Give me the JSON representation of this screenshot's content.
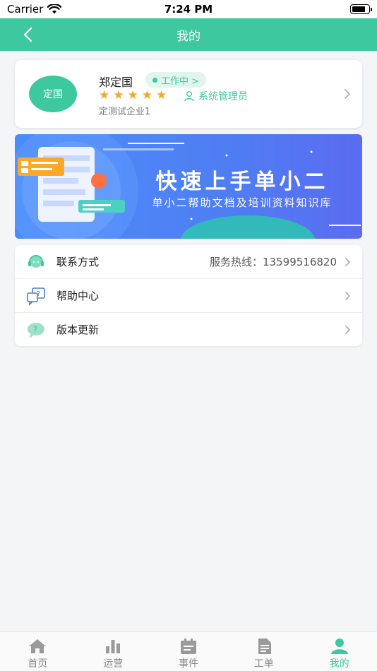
{
  "status_bar": {
    "carrier": "Carrier",
    "time": "7:24 PM"
  },
  "nav": {
    "title": "我的"
  },
  "profile": {
    "avatar_text": "定国",
    "name": "郑定国",
    "status_badge": "工作中 >",
    "rating_stars": 5,
    "role": "系统管理员",
    "company": "定测试企业1"
  },
  "banner": {
    "title": "快速上手单小二",
    "subtitle": "单小二帮助文档及培训资料知识库"
  },
  "menu": {
    "items": [
      {
        "label": "联系方式",
        "value": "服务热线：13599516820",
        "icon": "headset-icon"
      },
      {
        "label": "帮助中心",
        "value": "",
        "icon": "help-chat-icon"
      },
      {
        "label": "版本更新",
        "value": "",
        "icon": "update-icon"
      }
    ]
  },
  "tabs": [
    {
      "label": "首页",
      "icon": "home-icon",
      "active": false
    },
    {
      "label": "运营",
      "icon": "bar-chart-icon",
      "active": false
    },
    {
      "label": "事件",
      "icon": "calendar-icon",
      "active": false
    },
    {
      "label": "工单",
      "icon": "document-icon",
      "active": false
    },
    {
      "label": "我的",
      "icon": "person-icon",
      "active": true
    }
  ],
  "colors": {
    "accent": "#3ec8a0",
    "star": "#f5a623",
    "banner": "#4b8dfb"
  }
}
